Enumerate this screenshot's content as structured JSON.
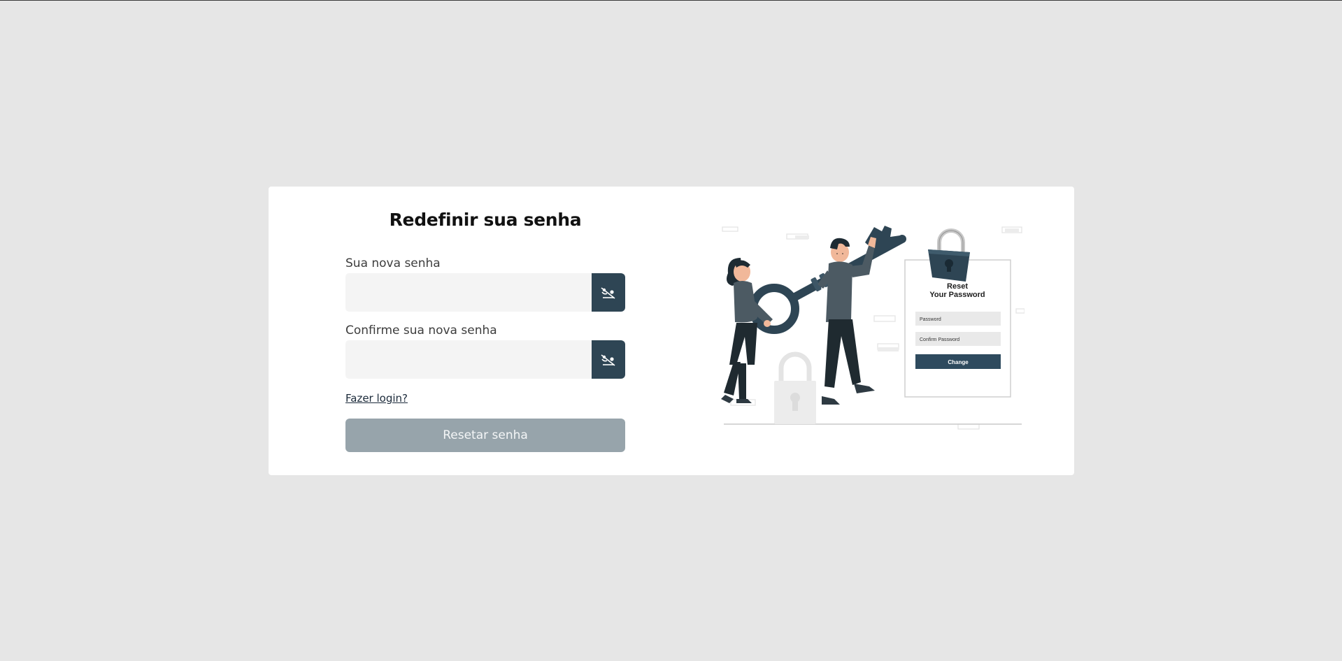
{
  "form": {
    "title": "Redefinir sua senha",
    "new_password_label": "Sua nova senha",
    "new_password_value": "",
    "confirm_password_label": "Confirme sua nova senha",
    "confirm_password_value": "",
    "login_link": "Fazer login?",
    "submit_label": "Resetar senha"
  },
  "icons": {
    "toggle_visibility": "eye-slash-icon"
  },
  "illustration": {
    "heading_line1": "Reset",
    "heading_line2": "Your Password",
    "password_placeholder": "Password",
    "confirm_placeholder": "Confirm Password",
    "button_label": "Change"
  },
  "colors": {
    "page_background": "#e6e6e6",
    "card_background": "#ffffff",
    "accent": "#2e4554",
    "disabled_button": "#97a4ab",
    "input_background": "#f4f4f4"
  }
}
